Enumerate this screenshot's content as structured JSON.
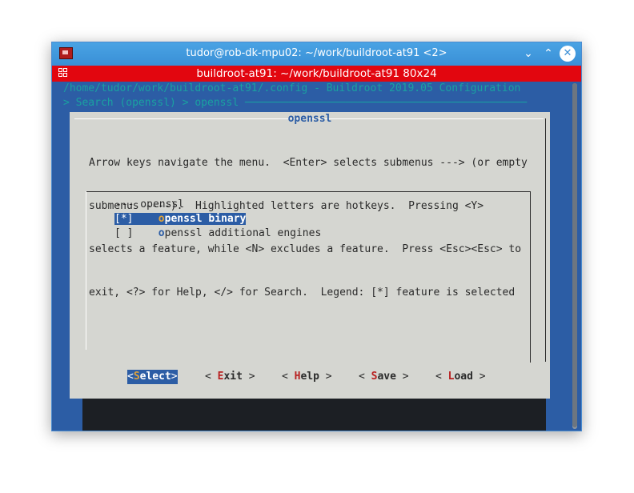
{
  "window": {
    "title": "tudor@rob-dk-mpu02: ~/work/buildroot-at91 <2>",
    "tab_title": "buildroot-at91: ~/work/buildroot-at91 80x24",
    "controls": {
      "minimize": "⌄",
      "maximize": "⌃",
      "close": "✕"
    }
  },
  "terminal": {
    "header_line": "/home/tudor/work/buildroot-at91/.config - Buildroot 2019.05 Configuration",
    "breadcrumb_line": "> Search (openssl) > openssl ─────────────────────────────────────────────"
  },
  "dialog": {
    "title": "openssl",
    "help_lines": [
      "Arrow keys navigate the menu.  <Enter> selects submenus ---> (or empty",
      "submenus ----).  Highlighted letters are hotkeys.  Pressing <Y>",
      "selects a feature, while <N> excludes a feature.  Press <Esc><Esc> to",
      "exit, <?> for Help, </> for Search.  Legend: [*] feature is selected"
    ],
    "menu_header": "--- openssl",
    "items": [
      {
        "check": "[*]",
        "hotkey": "o",
        "rest": "penssl binary",
        "selected": true
      },
      {
        "check": "[ ]",
        "hotkey": "o",
        "rest": "penssl additional engines",
        "selected": false
      }
    ],
    "buttons": [
      {
        "open": "<",
        "key": "S",
        "rest": "elect",
        "close": ">",
        "selected": true
      },
      {
        "open": "< ",
        "key": "E",
        "rest": "xit",
        "close": " >",
        "selected": false
      },
      {
        "open": "< ",
        "key": "H",
        "rest": "elp",
        "close": " >",
        "selected": false
      },
      {
        "open": "< ",
        "key": "S",
        "rest": "ave",
        "close": " >",
        "selected": false
      },
      {
        "open": "< ",
        "key": "L",
        "rest": "oad",
        "close": " >",
        "selected": false
      }
    ]
  }
}
